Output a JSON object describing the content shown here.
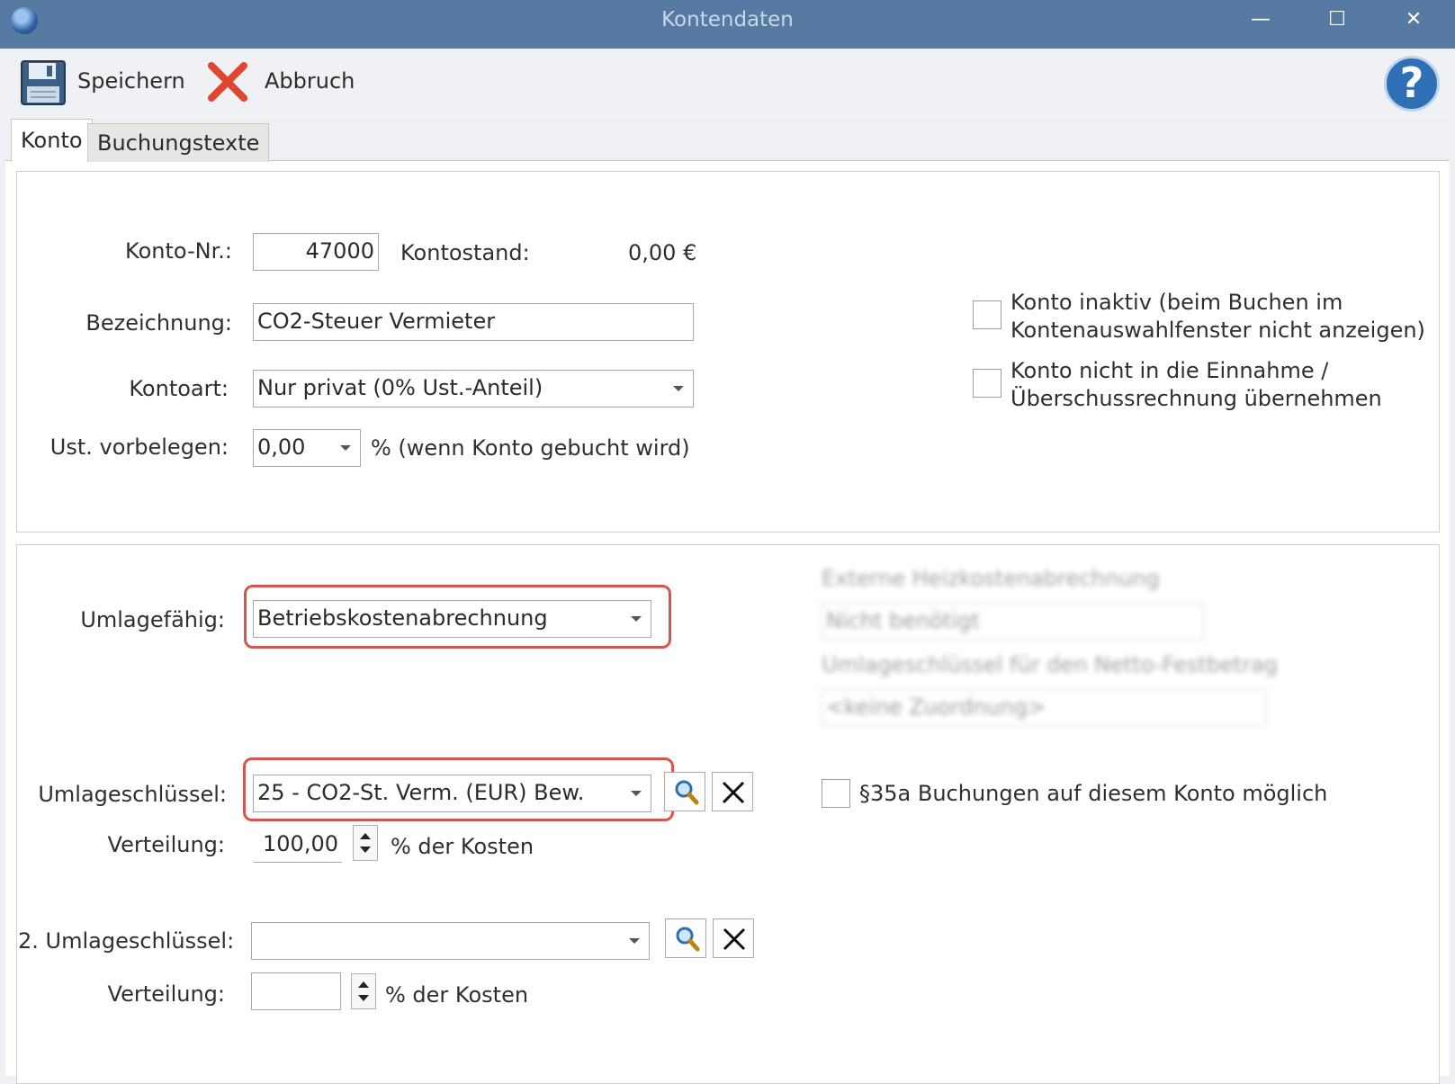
{
  "window": {
    "title": "Kontendaten",
    "controls": {
      "minimize": "—",
      "maximize": "☐",
      "close": "✕"
    }
  },
  "toolbar": {
    "save_label": "Speichern",
    "cancel_label": "Abbruch",
    "help_label": "?"
  },
  "tabs": [
    {
      "label": "Konto",
      "active": true
    },
    {
      "label": "Buchungstexte",
      "active": false
    }
  ],
  "account": {
    "number_label": "Konto-Nr.:",
    "number_value": "47000",
    "balance_label": "Kontostand:",
    "balance_value": "0,00 €",
    "name_label": "Bezeichnung:",
    "name_value": "CO2-Steuer Vermieter",
    "type_label": "Kontoart:",
    "type_value": "Nur privat (0% Ust.-Anteil)",
    "vat_label": "Ust. vorbelegen:",
    "vat_value": "0,00",
    "vat_suffix": "%  (wenn Konto gebucht wird)",
    "inactive_line1": "Konto inaktiv (beim Buchen im",
    "inactive_line2": "Kontenauswahlfenster nicht anzeigen)",
    "inactive_checked": false,
    "no_eur_line1": "Konto nicht in die Einnahme /",
    "no_eur_line2": "Überschussrechnung übernehmen",
    "no_eur_checked": false
  },
  "allocation": {
    "apportionable_label": "Umlagefähig:",
    "apportionable_value": "Betriebskostenabrechnung",
    "key_label": "Umlageschlüssel:",
    "key_value": "25 - CO2-St. Verm. (EUR) Bew.",
    "distribution_label": "Verteilung:",
    "distribution_value": "100,00",
    "distribution_suffix": "% der Kosten",
    "key2_label": "2. Umlageschlüssel:",
    "key2_value": "",
    "distribution2_label": "Verteilung:",
    "distribution2_value": "",
    "distribution2_suffix": "% der Kosten",
    "par35a_label": "§35a Buchungen auf diesem Konto möglich",
    "par35a_checked": false
  },
  "blurred_panel": {
    "heating_label": "Externe Heizkostenabrechnung",
    "heating_value": "Nicht benötigt",
    "net_key_label": "Umlageschlüssel für den Netto-Festbetrag",
    "net_key_value": "<keine Zuordnung>"
  },
  "colors": {
    "titlebar": "#577aa2",
    "highlight": "#d9534f",
    "help_blue": "#2f6fb5",
    "cancel_red": "#e0452f"
  },
  "icons": {
    "save": "floppy-disk-icon",
    "cancel": "red-x-icon",
    "help": "question-icon",
    "search": "magnifier-icon",
    "clear": "black-x-icon"
  }
}
